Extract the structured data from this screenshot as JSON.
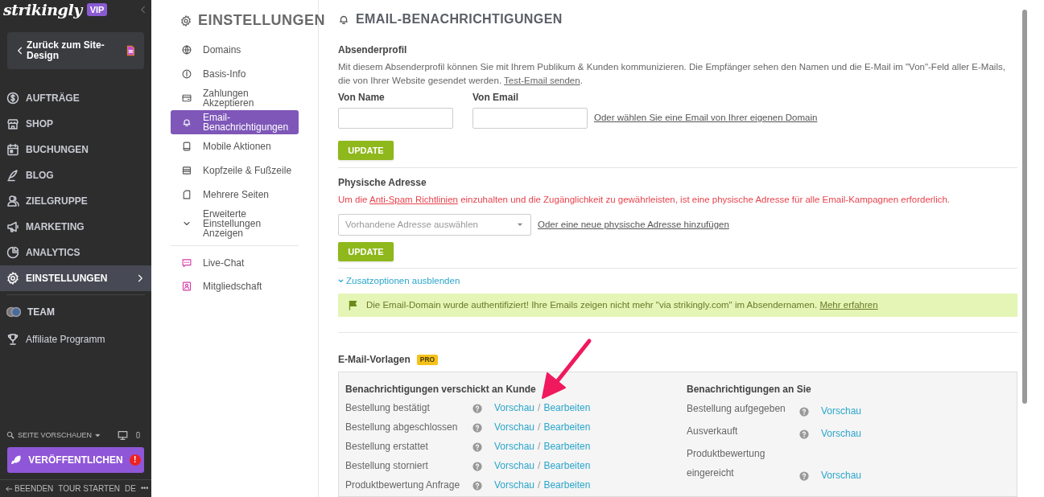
{
  "sidebar": {
    "logo": "strikingly",
    "badge": "VIP",
    "back_button": "Zurück zum Site-Design",
    "items": [
      {
        "label": "AUFTRÄGE",
        "selected": false
      },
      {
        "label": "SHOP",
        "selected": false
      },
      {
        "label": "BUCHUNGEN",
        "selected": false
      },
      {
        "label": "BLOG",
        "selected": false
      },
      {
        "label": "ZIELGRUPPE",
        "selected": false
      },
      {
        "label": "MARKETING",
        "selected": false
      },
      {
        "label": "ANALYTICS",
        "selected": false
      },
      {
        "label": "EINSTELLUNGEN",
        "selected": true
      }
    ],
    "extra_items": [
      {
        "label": "TEAM"
      },
      {
        "label": "Affiliate Programm"
      }
    ],
    "preview": "SEITE VORSCHAUEN",
    "publish": "VERÖFFENTLICHEN",
    "publish_alert": "!",
    "footer": [
      "BEENDEN",
      "TOUR STARTEN",
      "DE"
    ],
    "more": "•••"
  },
  "settings_nav": {
    "title": "EINSTELLUNGEN",
    "items": [
      {
        "label": "Domains",
        "selected": false
      },
      {
        "label": "Basis-Info",
        "selected": false
      },
      {
        "label": "Zahlungen Akzeptieren",
        "selected": false
      },
      {
        "label": "Email-Benachrichtigungen",
        "selected": true
      },
      {
        "label": "Mobile Aktionen",
        "selected": false
      },
      {
        "label": "Kopfzeile & Fußzeile",
        "selected": false
      },
      {
        "label": "Mehrere Seiten",
        "selected": false
      },
      {
        "label": "Erweiterte Einstellungen Anzeigen",
        "selected": false
      }
    ],
    "apps": [
      {
        "label": "Live-Chat"
      },
      {
        "label": "Mitgliedschaft"
      }
    ]
  },
  "content": {
    "title": "EMAIL-BENACHRICHTIGUNGEN",
    "sender": {
      "heading": "Absenderprofil",
      "text": "Mit diesem Absenderprofil können Sie mit Ihrem Publikum & Kunden kommunizieren. Die Empfänger sehen den Namen und die E-Mail im \"Von\"-Feld aller E-Mails, die von Ihrer Website gesendet werden.",
      "link": "Test-Email senden",
      "text_end": ".",
      "name_label": "Von Name",
      "email_label": "Von Email",
      "domain_link": "Oder wählen Sie eine Email von Ihrer eigenen Domain",
      "button": "UPDATE"
    },
    "address": {
      "heading": "Physische Adresse",
      "warning_before": "Um die",
      "warning_link": "Anti-Spam Richtlinien",
      "warning_after": "einzuhalten und die Zugänglichkeit zu gewährleisten, ist eine physische Adresse für alle Email-Kampagnen erforderlich.",
      "select_placeholder": "Vorhandene Adresse auswählen",
      "add_link": "Oder eine neue physische Adresse hinzufügen",
      "button": "UPDATE"
    },
    "toggle": "Zusatzoptionen ausblenden",
    "expanded": true,
    "notice": {
      "text": "Die Email-Domain wurde authentifiziert! Ihre Emails zeigen nicht mehr \"via strikingly.com\" im Absendernamen.",
      "link": "Mehr erfahren"
    },
    "templates": {
      "heading": "E-Mail-Vorlagen",
      "badge": "PRO",
      "customer_heading": "Benachrichtigungen verschickt an Kunde",
      "customer": [
        {
          "label": "Bestellung bestätigt",
          "preview": "Vorschau",
          "sep": "/",
          "edit": "Bearbeiten"
        },
        {
          "label": "Bestellung abgeschlossen",
          "preview": "Vorschau",
          "sep": "/",
          "edit": "Bearbeiten"
        },
        {
          "label": "Bestellung erstattet",
          "preview": "Vorschau",
          "sep": "/",
          "edit": "Bearbeiten"
        },
        {
          "label": "Bestellung storniert",
          "preview": "Vorschau",
          "sep": "/",
          "edit": "Bearbeiten"
        },
        {
          "label": "Produktbewertung Anfrage",
          "preview": "Vorschau",
          "sep": "/",
          "edit": "Bearbeiten"
        }
      ],
      "owner_heading": "Benachrichtigungen an Sie",
      "owner": [
        {
          "label": "Bestellung aufgegeben",
          "preview": "Vorschau"
        },
        {
          "label": "Ausverkauft",
          "preview": "Vorschau"
        },
        {
          "label": "Produktbewertung eingereicht",
          "preview": "Vorschau"
        }
      ]
    }
  }
}
